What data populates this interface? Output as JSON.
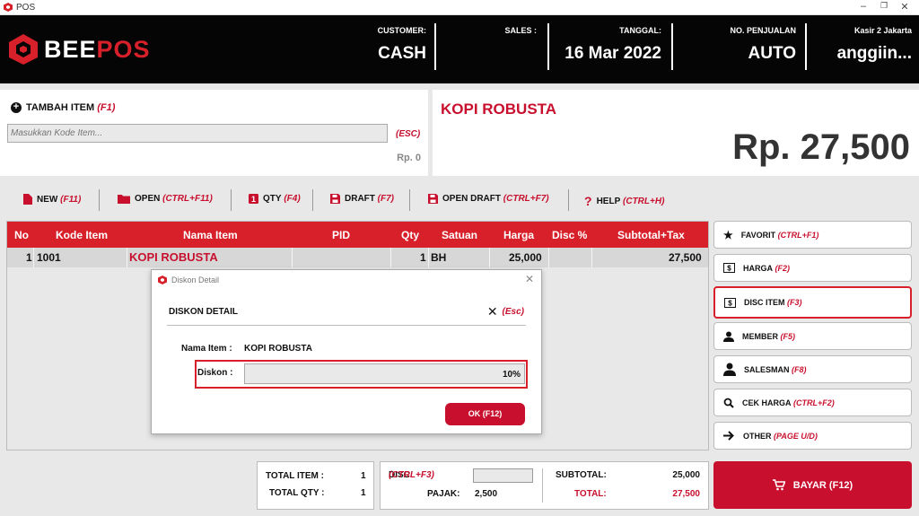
{
  "window": {
    "title": "POS"
  },
  "brand": {
    "name_part1": "BEE",
    "name_part2": "POS",
    "accent": "#d8202a"
  },
  "header": {
    "customer_label": "CUSTOMER:",
    "customer_value": "CASH",
    "sales_label": "SALES :",
    "sales_value": "",
    "date_label": "TANGGAL:",
    "date_value": "16 Mar 2022",
    "sale_no_label": "NO. PENJUALAN",
    "sale_no_value": "AUTO",
    "cashier_label": "Kasir 2 Jakarta",
    "cashier_value": "anggiin..."
  },
  "add_item": {
    "label": "TAMBAH ITEM",
    "shortcut": "(F1)",
    "placeholder": "Masukkan Kode Item...",
    "esc": "(ESC)",
    "amount": "Rp. 0"
  },
  "display": {
    "item_name": "KOPI ROBUSTA",
    "price": "Rp. 27,500"
  },
  "toolbar": [
    {
      "label": "NEW",
      "shortcut": "(F11)"
    },
    {
      "label": "OPEN",
      "shortcut": "(CTRL+F11)"
    },
    {
      "label": "QTY",
      "shortcut": "(F4)"
    },
    {
      "label": "DRAFT",
      "shortcut": "(F7)"
    },
    {
      "label": "OPEN DRAFT",
      "shortcut": "(CTRL+F7)"
    },
    {
      "label": "HELP",
      "shortcut": "(CTRL+H)"
    }
  ],
  "table": {
    "headers": [
      "No",
      "Kode Item",
      "Nama Item",
      "PID",
      "Qty",
      "Satuan",
      "Harga",
      "Disc %",
      "Subtotal+Tax"
    ],
    "rows": [
      [
        "1",
        "1001",
        "KOPI ROBUSTA",
        "",
        "1",
        "BH",
        "25,000",
        "",
        "27,500"
      ]
    ]
  },
  "side_buttons": [
    {
      "label": "FAVORIT",
      "shortcut": "(CTRL+F1)",
      "icon": "star-icon"
    },
    {
      "label": "HARGA",
      "shortcut": "(F2)",
      "icon": "dollar-icon"
    },
    {
      "label": "DISC ITEM",
      "shortcut": "(F3)",
      "icon": "dollar-icon"
    },
    {
      "label": "MEMBER",
      "shortcut": "(F5)",
      "icon": "user-icon"
    },
    {
      "label": "SALESMAN",
      "shortcut": "(F8)",
      "icon": "salesman-icon"
    },
    {
      "label": "CEK HARGA",
      "shortcut": "(CTRL+F2)",
      "icon": "search-icon"
    },
    {
      "label": "OTHER",
      "shortcut": "(PAGE U/D)",
      "icon": "arrow-right-icon"
    }
  ],
  "pay_button": {
    "label": "BAYAR (F12)"
  },
  "summary": {
    "total_item_label": "TOTAL ITEM :",
    "total_item_value": "1",
    "total_qty_label": "TOTAL QTY :",
    "total_qty_value": "1",
    "disc_label": "DISC",
    "disc_shortcut": "(CTRL+F3)",
    "disc_value": "",
    "pajak_label": "PAJAK:",
    "pajak_value": "2,500",
    "subtotal_label": "SUBTOTAL:",
    "subtotal_value": "25,000",
    "total_label": "TOTAL:",
    "total_value": "27,500"
  },
  "dialog": {
    "title": "Diskon Detail",
    "heading": "DISKON DETAIL",
    "close_label": "(Esc)",
    "name_label": "Nama Item :",
    "name_value": "KOPI ROBUSTA",
    "discount_label": "Diskon :",
    "discount_value": "10%",
    "ok_label": "OK (F12)"
  }
}
